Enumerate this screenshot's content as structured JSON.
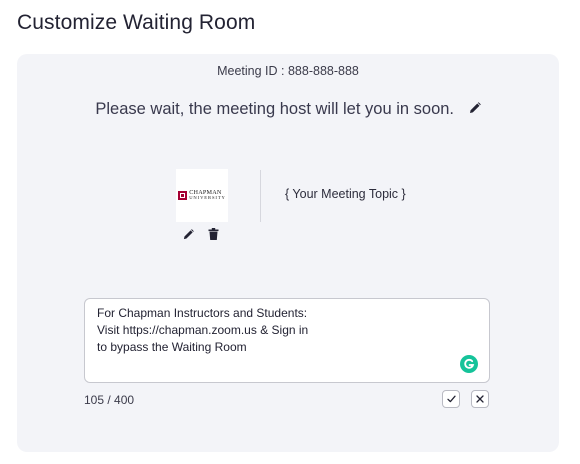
{
  "page": {
    "title": "Customize Waiting Room"
  },
  "panel": {
    "meeting_id": "Meeting ID : 888-888-888",
    "wait_message": "Please wait, the meeting host will let you in soon.",
    "logo": {
      "line1": "CHAPMAN",
      "line2": "UNIVERSITY",
      "brand_color": "#a50034"
    },
    "topic": "{ Your Meeting Topic }",
    "description": {
      "lines": [
        "For Chapman Instructors and Students:",
        "Visit https://chapman.zoom.us & Sign in",
        "to bypass the Waiting Room"
      ],
      "char_count": "105 / 400"
    },
    "icons": {
      "edit_message": "pencil-icon",
      "edit_logo": "pencil-icon",
      "delete_logo": "trash-icon",
      "grammarly": "grammarly-icon",
      "save": "check-icon",
      "cancel": "close-icon"
    },
    "colors": {
      "panel_bg": "#f3f4f8",
      "grammarly": "#15c39a"
    }
  }
}
